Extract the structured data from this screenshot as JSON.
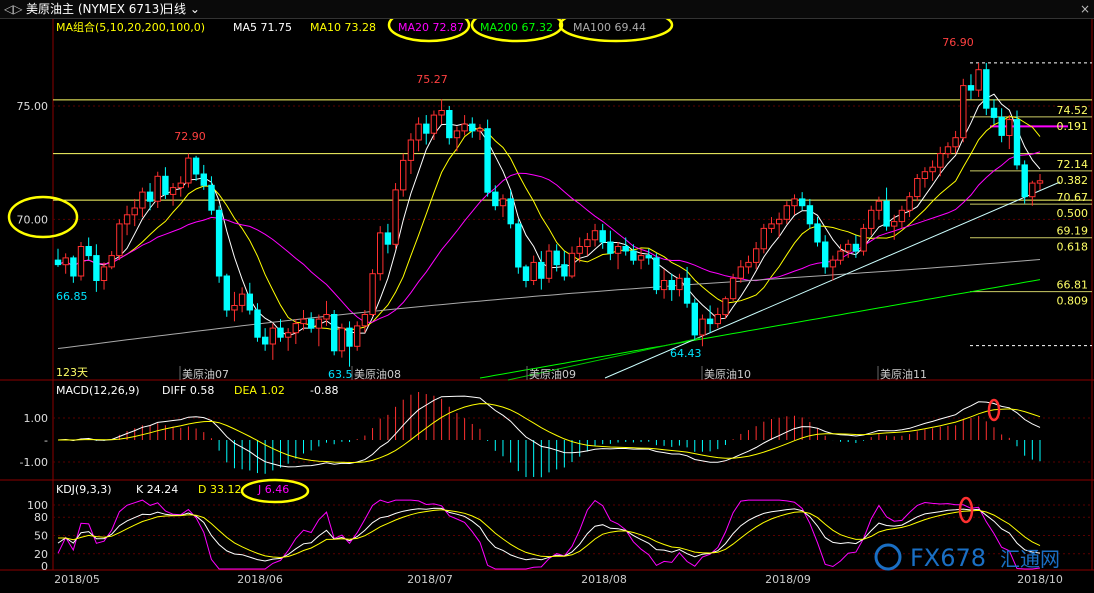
{
  "toolbar": {
    "nav_arrows": "◁▷",
    "title": "美原油主 (NYMEX 6713)",
    "period": "日线",
    "close_x": "×"
  },
  "price_panel": {
    "ma_group_label": "MA组合(5,10,20,200,100,0)",
    "ma_values": [
      {
        "label": "MA5 71.75",
        "color": "#ffffff"
      },
      {
        "label": "MA10 73.28",
        "color": "#ffff00"
      },
      {
        "label": "MA20 72.87",
        "color": "#ff00ff"
      },
      {
        "label": "MA200 67.32",
        "color": "#00ff00"
      },
      {
        "label": "MA100 69.44",
        "color": "#aaaaaa"
      }
    ],
    "y_labels": [
      "75.00",
      "70.00"
    ],
    "annotations": [
      "76.90",
      "75.27",
      "72.90",
      "66.85",
      "63.5",
      "64.43"
    ],
    "fib_labels": [
      {
        "price": "74.52",
        "ratio": "0.191"
      },
      {
        "price": "72.14",
        "ratio": "0.382"
      },
      {
        "price": "70.67",
        "ratio": "0.500"
      },
      {
        "price": "69.19",
        "ratio": "0.618"
      },
      {
        "price": "66.81",
        "ratio": "0.809"
      }
    ],
    "days_label": "123天",
    "contract_labels": [
      "美原油07",
      "美原油08",
      "美原油09",
      "美原油10",
      "美原油11"
    ]
  },
  "macd_panel": {
    "label": "MACD(12,26,9)",
    "diff": "DIFF 0.58",
    "dea": "DEA 1.02",
    "macd": "-0.88",
    "y_labels": [
      "1.00",
      "-",
      "-1.00"
    ]
  },
  "kdj_panel": {
    "label": "KDJ(9,3,3)",
    "k": "K 24.24",
    "d": "D 33.12",
    "j": "J 6.46",
    "y_labels": [
      "100",
      "80",
      "50",
      "20",
      "0"
    ]
  },
  "x_axis": {
    "labels": [
      "2018/05",
      "2018/06",
      "2018/07",
      "2018/08",
      "2018/09",
      "2018/10"
    ]
  },
  "watermark": {
    "text": "FX678",
    "suffix": "汇通网"
  },
  "colors": {
    "up": "#ff3030",
    "down": "#00ffff",
    "ma5": "#ffffff",
    "ma10": "#ffff00",
    "ma20": "#ff00ff",
    "ma100": "#aaaaaa",
    "ma200": "#00ff00",
    "highlight": "#ffff00",
    "circle_red": "#ff3030"
  },
  "chart_data": {
    "type": "candlestick",
    "ylim": [
      63,
      78
    ],
    "candles": [
      [
        68.2,
        68.7,
        67.9,
        68.0
      ],
      [
        68.0,
        68.5,
        67.6,
        68.3
      ],
      [
        68.3,
        68.4,
        67.2,
        67.5
      ],
      [
        67.5,
        69.0,
        67.3,
        68.8
      ],
      [
        68.8,
        69.2,
        68.2,
        68.4
      ],
      [
        68.4,
        68.9,
        66.8,
        67.3
      ],
      [
        67.3,
        68.1,
        66.9,
        67.9
      ],
      [
        67.9,
        68.6,
        67.8,
        68.4
      ],
      [
        68.4,
        70.0,
        68.2,
        69.8
      ],
      [
        69.8,
        70.6,
        69.3,
        70.2
      ],
      [
        70.2,
        70.9,
        69.7,
        70.5
      ],
      [
        70.5,
        71.4,
        70.1,
        71.2
      ],
      [
        71.2,
        71.6,
        70.4,
        70.8
      ],
      [
        70.8,
        72.1,
        70.5,
        71.9
      ],
      [
        71.9,
        72.3,
        70.9,
        71.1
      ],
      [
        71.1,
        71.6,
        70.6,
        71.4
      ],
      [
        71.4,
        71.9,
        71.0,
        71.6
      ],
      [
        71.6,
        72.9,
        71.4,
        72.7
      ],
      [
        72.7,
        72.8,
        71.7,
        72.0
      ],
      [
        72.0,
        72.4,
        71.3,
        71.5
      ],
      [
        71.5,
        71.9,
        70.2,
        70.4
      ],
      [
        70.4,
        70.6,
        67.2,
        67.5
      ],
      [
        67.5,
        67.6,
        65.7,
        66.0
      ],
      [
        66.0,
        66.8,
        65.5,
        66.2
      ],
      [
        66.2,
        67.0,
        65.9,
        66.7
      ],
      [
        66.7,
        67.2,
        65.8,
        66.0
      ],
      [
        66.0,
        66.3,
        64.6,
        64.8
      ],
      [
        64.8,
        65.2,
        64.2,
        64.5
      ],
      [
        64.5,
        65.4,
        63.8,
        65.2
      ],
      [
        65.2,
        65.6,
        64.6,
        64.8
      ],
      [
        64.8,
        65.2,
        64.2,
        65.0
      ],
      [
        65.0,
        65.6,
        64.5,
        65.4
      ],
      [
        65.4,
        66.0,
        65.1,
        65.6
      ],
      [
        65.6,
        65.9,
        65.0,
        65.2
      ],
      [
        65.2,
        65.8,
        64.4,
        65.6
      ],
      [
        65.6,
        66.4,
        65.3,
        65.8
      ],
      [
        65.8,
        66.0,
        64.0,
        64.2
      ],
      [
        64.2,
        65.4,
        63.9,
        65.2
      ],
      [
        65.2,
        65.5,
        63.5,
        64.4
      ],
      [
        64.4,
        65.5,
        64.2,
        65.3
      ],
      [
        65.3,
        66.0,
        65.0,
        65.8
      ],
      [
        65.8,
        67.8,
        65.7,
        67.6
      ],
      [
        67.6,
        69.7,
        67.3,
        69.4
      ],
      [
        69.4,
        69.8,
        68.5,
        68.9
      ],
      [
        68.9,
        71.6,
        68.7,
        71.3
      ],
      [
        71.3,
        72.9,
        71.0,
        72.6
      ],
      [
        72.6,
        73.8,
        72.0,
        73.5
      ],
      [
        73.5,
        74.5,
        73.0,
        74.2
      ],
      [
        74.2,
        74.6,
        73.3,
        73.8
      ],
      [
        73.8,
        74.8,
        73.5,
        74.6
      ],
      [
        74.6,
        75.3,
        74.2,
        74.8
      ],
      [
        74.8,
        75.0,
        73.3,
        73.6
      ],
      [
        73.6,
        74.1,
        73.0,
        73.9
      ],
      [
        73.9,
        74.6,
        73.7,
        74.2
      ],
      [
        74.2,
        74.5,
        73.6,
        73.9
      ],
      [
        73.9,
        74.2,
        73.5,
        74.0
      ],
      [
        74.0,
        74.4,
        71.0,
        71.2
      ],
      [
        71.2,
        71.5,
        70.4,
        70.6
      ],
      [
        70.6,
        71.1,
        70.1,
        70.9
      ],
      [
        70.9,
        71.3,
        69.6,
        69.8
      ],
      [
        69.8,
        70.0,
        67.6,
        67.9
      ],
      [
        67.9,
        68.0,
        67.0,
        67.3
      ],
      [
        67.3,
        68.4,
        67.1,
        68.1
      ],
      [
        68.1,
        68.6,
        66.9,
        67.4
      ],
      [
        67.4,
        68.9,
        67.2,
        68.6
      ],
      [
        68.6,
        68.9,
        67.7,
        68.0
      ],
      [
        68.0,
        68.6,
        67.3,
        67.5
      ],
      [
        67.5,
        68.8,
        67.4,
        68.5
      ],
      [
        68.5,
        69.2,
        68.1,
        68.8
      ],
      [
        68.8,
        69.4,
        68.4,
        69.1
      ],
      [
        69.1,
        69.8,
        68.8,
        69.5
      ],
      [
        69.5,
        69.8,
        68.7,
        69.0
      ],
      [
        69.0,
        69.5,
        68.2,
        68.5
      ],
      [
        68.5,
        69.0,
        67.8,
        68.8
      ],
      [
        68.8,
        69.2,
        68.4,
        68.6
      ],
      [
        68.6,
        68.9,
        68.0,
        68.2
      ],
      [
        68.2,
        68.7,
        67.8,
        68.4
      ],
      [
        68.4,
        68.7,
        68.0,
        68.3
      ],
      [
        68.3,
        68.5,
        66.7,
        66.9
      ],
      [
        66.9,
        67.8,
        66.5,
        67.3
      ],
      [
        67.3,
        67.6,
        66.4,
        66.9
      ],
      [
        66.9,
        67.6,
        66.6,
        67.4
      ],
      [
        67.4,
        67.9,
        66.1,
        66.3
      ],
      [
        66.3,
        66.5,
        64.7,
        64.9
      ],
      [
        64.9,
        65.8,
        64.4,
        65.6
      ],
      [
        65.6,
        66.2,
        65.0,
        65.4
      ],
      [
        65.4,
        66.1,
        65.2,
        65.8
      ],
      [
        65.8,
        66.6,
        65.6,
        66.5
      ],
      [
        66.5,
        67.6,
        66.4,
        67.4
      ],
      [
        67.4,
        68.2,
        67.2,
        67.9
      ],
      [
        67.9,
        68.4,
        67.6,
        68.1
      ],
      [
        68.1,
        69.0,
        67.8,
        68.7
      ],
      [
        68.7,
        69.8,
        68.5,
        69.6
      ],
      [
        69.6,
        70.1,
        69.4,
        69.8
      ],
      [
        69.8,
        70.3,
        69.2,
        70.0
      ],
      [
        70.0,
        70.8,
        69.8,
        70.6
      ],
      [
        70.6,
        71.1,
        70.2,
        70.9
      ],
      [
        70.9,
        71.2,
        70.4,
        70.6
      ],
      [
        70.6,
        70.9,
        69.6,
        69.8
      ],
      [
        69.8,
        70.1,
        68.8,
        69.0
      ],
      [
        69.0,
        69.3,
        67.6,
        67.9
      ],
      [
        67.9,
        68.4,
        67.3,
        68.2
      ],
      [
        68.2,
        68.9,
        68.0,
        68.6
      ],
      [
        68.6,
        69.1,
        68.3,
        68.9
      ],
      [
        68.9,
        69.3,
        68.3,
        68.6
      ],
      [
        68.6,
        69.8,
        68.4,
        69.6
      ],
      [
        69.6,
        70.6,
        69.3,
        70.4
      ],
      [
        70.4,
        71.0,
        70.0,
        70.8
      ],
      [
        70.8,
        71.4,
        69.5,
        69.7
      ],
      [
        69.7,
        70.2,
        69.1,
        69.9
      ],
      [
        69.9,
        70.6,
        69.6,
        70.4
      ],
      [
        70.4,
        71.2,
        70.1,
        71.0
      ],
      [
        71.0,
        72.0,
        70.8,
        71.8
      ],
      [
        71.8,
        72.3,
        71.4,
        72.1
      ],
      [
        72.1,
        72.6,
        71.7,
        72.3
      ],
      [
        72.3,
        73.2,
        71.9,
        72.9
      ],
      [
        72.9,
        73.4,
        72.7,
        73.2
      ],
      [
        73.2,
        73.9,
        72.9,
        73.6
      ],
      [
        73.6,
        76.2,
        73.4,
        75.9
      ],
      [
        75.9,
        76.4,
        75.3,
        75.7
      ],
      [
        75.7,
        76.9,
        75.4,
        76.6
      ],
      [
        76.6,
        76.9,
        74.6,
        74.9
      ],
      [
        74.9,
        75.3,
        74.2,
        74.5
      ],
      [
        74.5,
        74.9,
        73.4,
        73.7
      ],
      [
        73.7,
        74.6,
        73.1,
        74.4
      ],
      [
        74.4,
        74.8,
        72.2,
        72.4
      ],
      [
        72.4,
        72.6,
        70.7,
        71.0
      ],
      [
        71.0,
        71.7,
        70.6,
        71.6
      ],
      [
        71.6,
        72.0,
        71.3,
        71.7
      ]
    ]
  }
}
